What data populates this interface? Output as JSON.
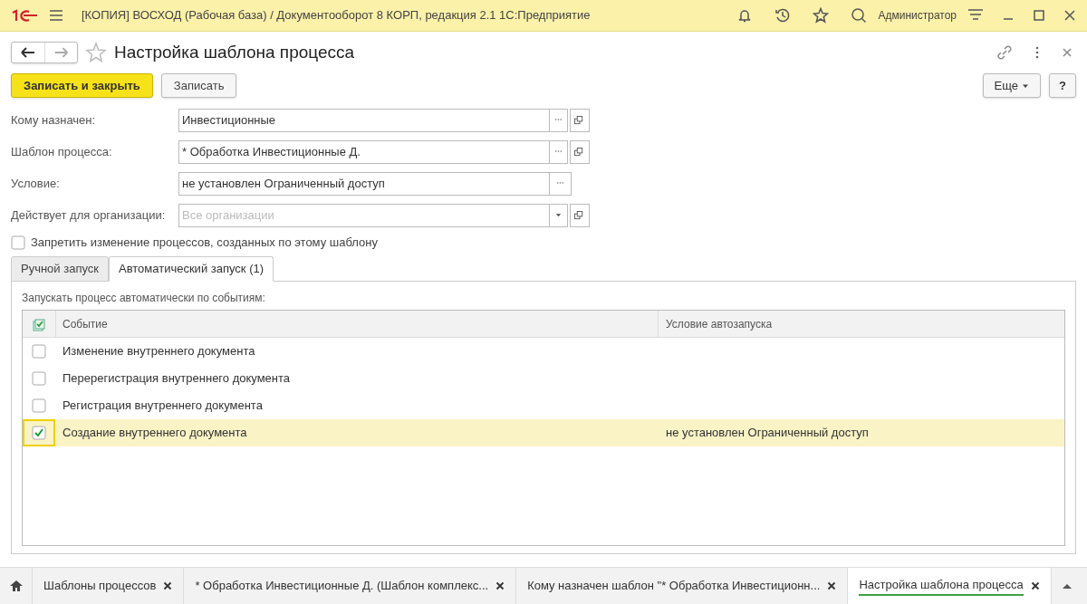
{
  "titlebar": {
    "title": "[КОПИЯ] ВОСХОД (Рабочая база) / Документооборот 8 КОРП, редакция 2.1 1С:Предприятие",
    "user": "Администратор"
  },
  "form": {
    "title": "Настройка шаблона процесса",
    "buttons": [
      {
        "label": "Записать и закрыть",
        "kind": "primary"
      },
      {
        "label": "Записать",
        "kind": "normal"
      }
    ],
    "more": "Еще",
    "help": "?"
  },
  "fields": [
    {
      "label": "Кому назначен:",
      "value": "Инвестиционные",
      "kind": "ref"
    },
    {
      "label": "Шаблон процесса:",
      "value": "* Обработка Инвестиционные Д.",
      "kind": "ref"
    },
    {
      "label": "Условие:",
      "value": "не установлен Ограниченный доступ",
      "kind": "choice"
    },
    {
      "label": "Действует для организации:",
      "placeholder": "Все организации",
      "kind": "dropdown"
    }
  ],
  "lock_checkbox": {
    "label": "Запретить изменение процессов, созданных по этому шаблону",
    "checked": false
  },
  "tabs": [
    {
      "label": "Ручной запуск",
      "selected": false
    },
    {
      "label": "Автоматический запуск (1)",
      "selected": true
    }
  ],
  "events_caption": "Запускать процесс автоматически по событиям:",
  "table": {
    "columns": [
      "Событие",
      "Условие автозапуска"
    ],
    "rows": [
      {
        "event": "Изменение внутреннего документа",
        "checked": false,
        "selected": false
      },
      {
        "event": "Перерегистрация внутреннего документа",
        "checked": false,
        "selected": false
      },
      {
        "event": "Регистрация внутреннего документа",
        "checked": false,
        "selected": false
      },
      {
        "event": "Создание внутреннего документа",
        "condition": "не установлен Ограниченный доступ",
        "checked": true,
        "selected": true
      }
    ]
  },
  "taskbar": [
    {
      "label": "Шаблоны процессов",
      "selected": false
    },
    {
      "label": "* Обработка Инвестиционные Д. (Шаблон комплекс...",
      "selected": false
    },
    {
      "label": "Кому назначен шаблон \"* Обработка Инвестиционн...",
      "selected": false
    },
    {
      "label": "Настройка шаблона процесса",
      "selected": true
    }
  ]
}
